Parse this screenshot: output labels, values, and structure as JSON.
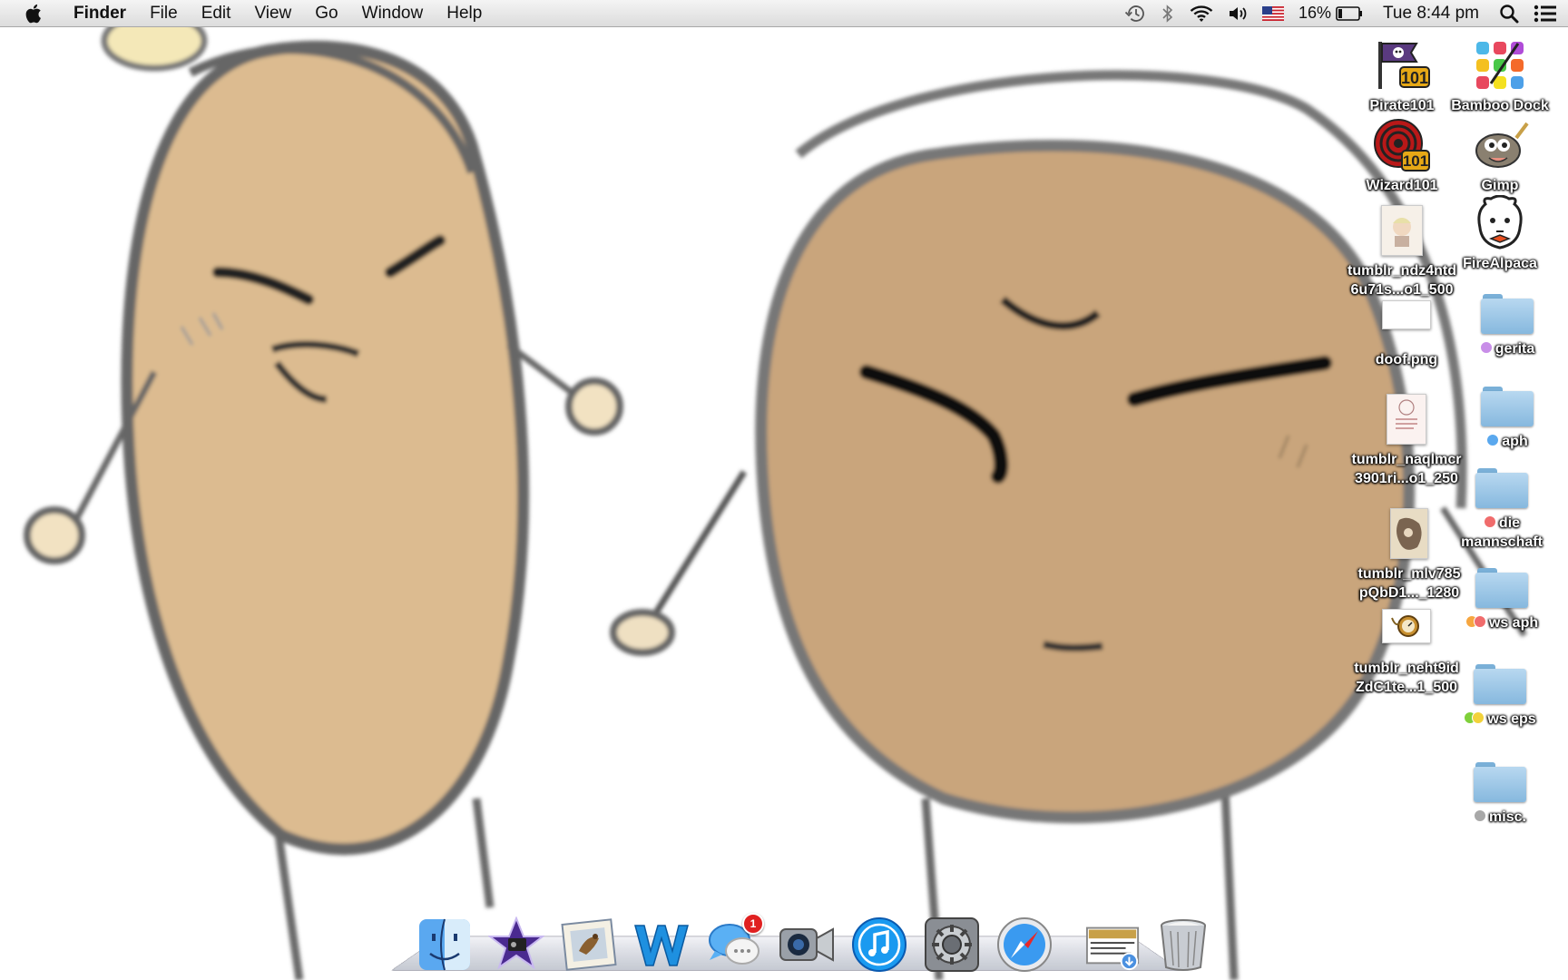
{
  "menubar": {
    "app_name": "Finder",
    "items": [
      "File",
      "Edit",
      "View",
      "Go",
      "Window",
      "Help"
    ],
    "battery_percent": "16%",
    "clock": "Tue 8:44 pm",
    "status_icons": [
      "time-machine-icon",
      "bluetooth-icon",
      "wifi-icon",
      "volume-icon",
      "us-flag-input-icon",
      "battery-icon",
      "spotlight-icon",
      "notification-center-icon"
    ]
  },
  "desktop": {
    "icons": [
      {
        "label": "Pirate101",
        "icon": "pirate101-app-icon"
      },
      {
        "label": "Bamboo Dock",
        "icon": "bamboo-dock-app-icon"
      },
      {
        "label": "Wizard101",
        "icon": "wizard101-app-icon"
      },
      {
        "label": "Gimp",
        "icon": "gimp-app-icon"
      },
      {
        "label": "tumblr_ndz4ntd\n6u71s...o1_500",
        "icon": "image-file-icon"
      },
      {
        "label": "FireAlpaca",
        "icon": "firealpaca-app-icon"
      },
      {
        "label": "doof.png",
        "icon": "image-file-icon"
      },
      {
        "label": "gerita",
        "icon": "folder-icon",
        "tag_color": "#c88ee8"
      },
      {
        "label": "tumblr_naqlmcr\n3901ri...o1_250",
        "icon": "image-file-icon"
      },
      {
        "label": "aph",
        "icon": "folder-icon",
        "tag_color": "#5aa8ee"
      },
      {
        "label": "die\nmannschaft",
        "icon": "folder-icon",
        "tag_color": "#f06c6c"
      },
      {
        "label": "tumblr_mlv785\npQbD1..._1280",
        "icon": "image-file-icon"
      },
      {
        "label": "ws aph",
        "icon": "folder-icon",
        "tag_color": "#f6a640",
        "tag_color2": "#f06c6c"
      },
      {
        "label": "tumblr_neht9id\nZdC1te...1_500",
        "icon": "image-file-icon"
      },
      {
        "label": "ws eps",
        "icon": "folder-icon",
        "tag_color": "#7fd03a",
        "tag_color2": "#f2d23a"
      },
      {
        "label": "misc.",
        "icon": "folder-icon",
        "tag_color": "#a8a8a8"
      }
    ]
  },
  "dock": {
    "apps": [
      {
        "name": "finder-icon"
      },
      {
        "name": "imovie-icon"
      },
      {
        "name": "mail-icon"
      },
      {
        "name": "word-icon"
      },
      {
        "name": "messages-icon",
        "badge": "1"
      },
      {
        "name": "facetime-icon"
      },
      {
        "name": "itunes-icon"
      },
      {
        "name": "system-preferences-icon"
      },
      {
        "name": "safari-icon"
      }
    ],
    "right": [
      {
        "name": "downloads-stack-icon"
      },
      {
        "name": "trash-icon"
      }
    ]
  },
  "colors": {
    "potato_fill": "#dcbb90",
    "potato_fill_dark": "#c5a07a",
    "outline": "#5a5a5a",
    "menubar_bg": "#ececec"
  }
}
